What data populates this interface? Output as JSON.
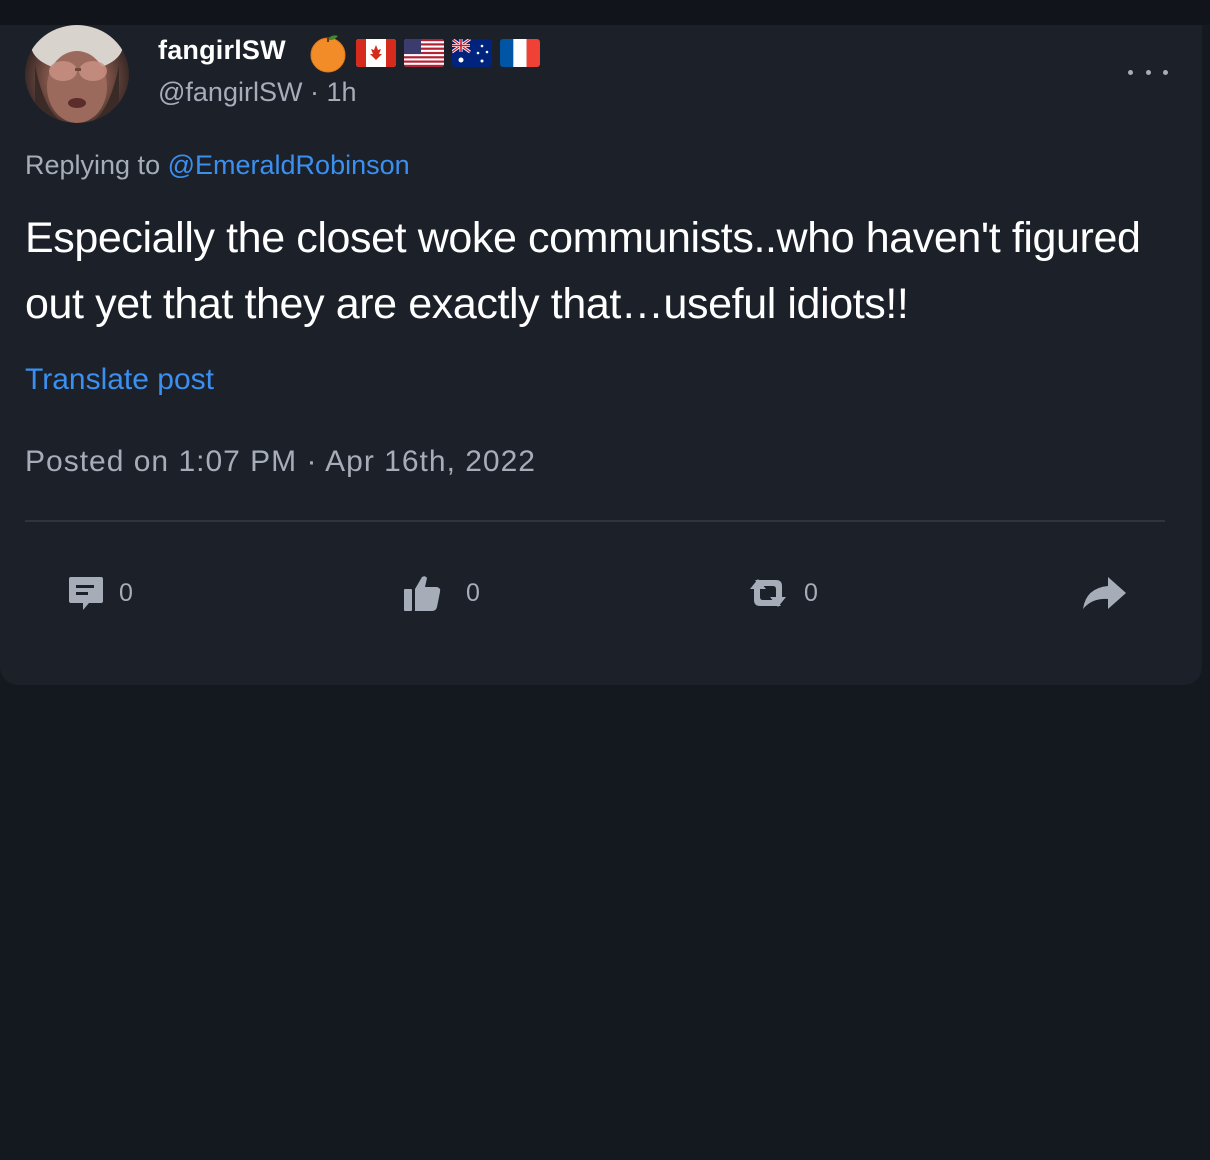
{
  "post": {
    "display_name": "fangirlSW",
    "handle": "@fangirlSW",
    "separator": "·",
    "age": "1h",
    "reply_prefix": "Replying to",
    "reply_mention": "@EmeraldRobinson",
    "text": "Especially the closet woke communists..who haven't figured out yet that they are exactly that…useful idiots!!",
    "translate_label": "Translate post",
    "posted_label": "Posted on 1:07 PM · Apr 16th, 2022",
    "badges": [
      "orange-emoji",
      "canada-flag",
      "usa-flag",
      "australia-flag",
      "france-flag"
    ]
  },
  "actions": {
    "comment_count": "0",
    "like_count": "0",
    "repost_count": "0"
  },
  "colors": {
    "background": "#141920",
    "card": "#1b2029",
    "accent": "#3b8ff0",
    "muted_text": "#a6adb8",
    "primary_text": "#ffffff"
  }
}
